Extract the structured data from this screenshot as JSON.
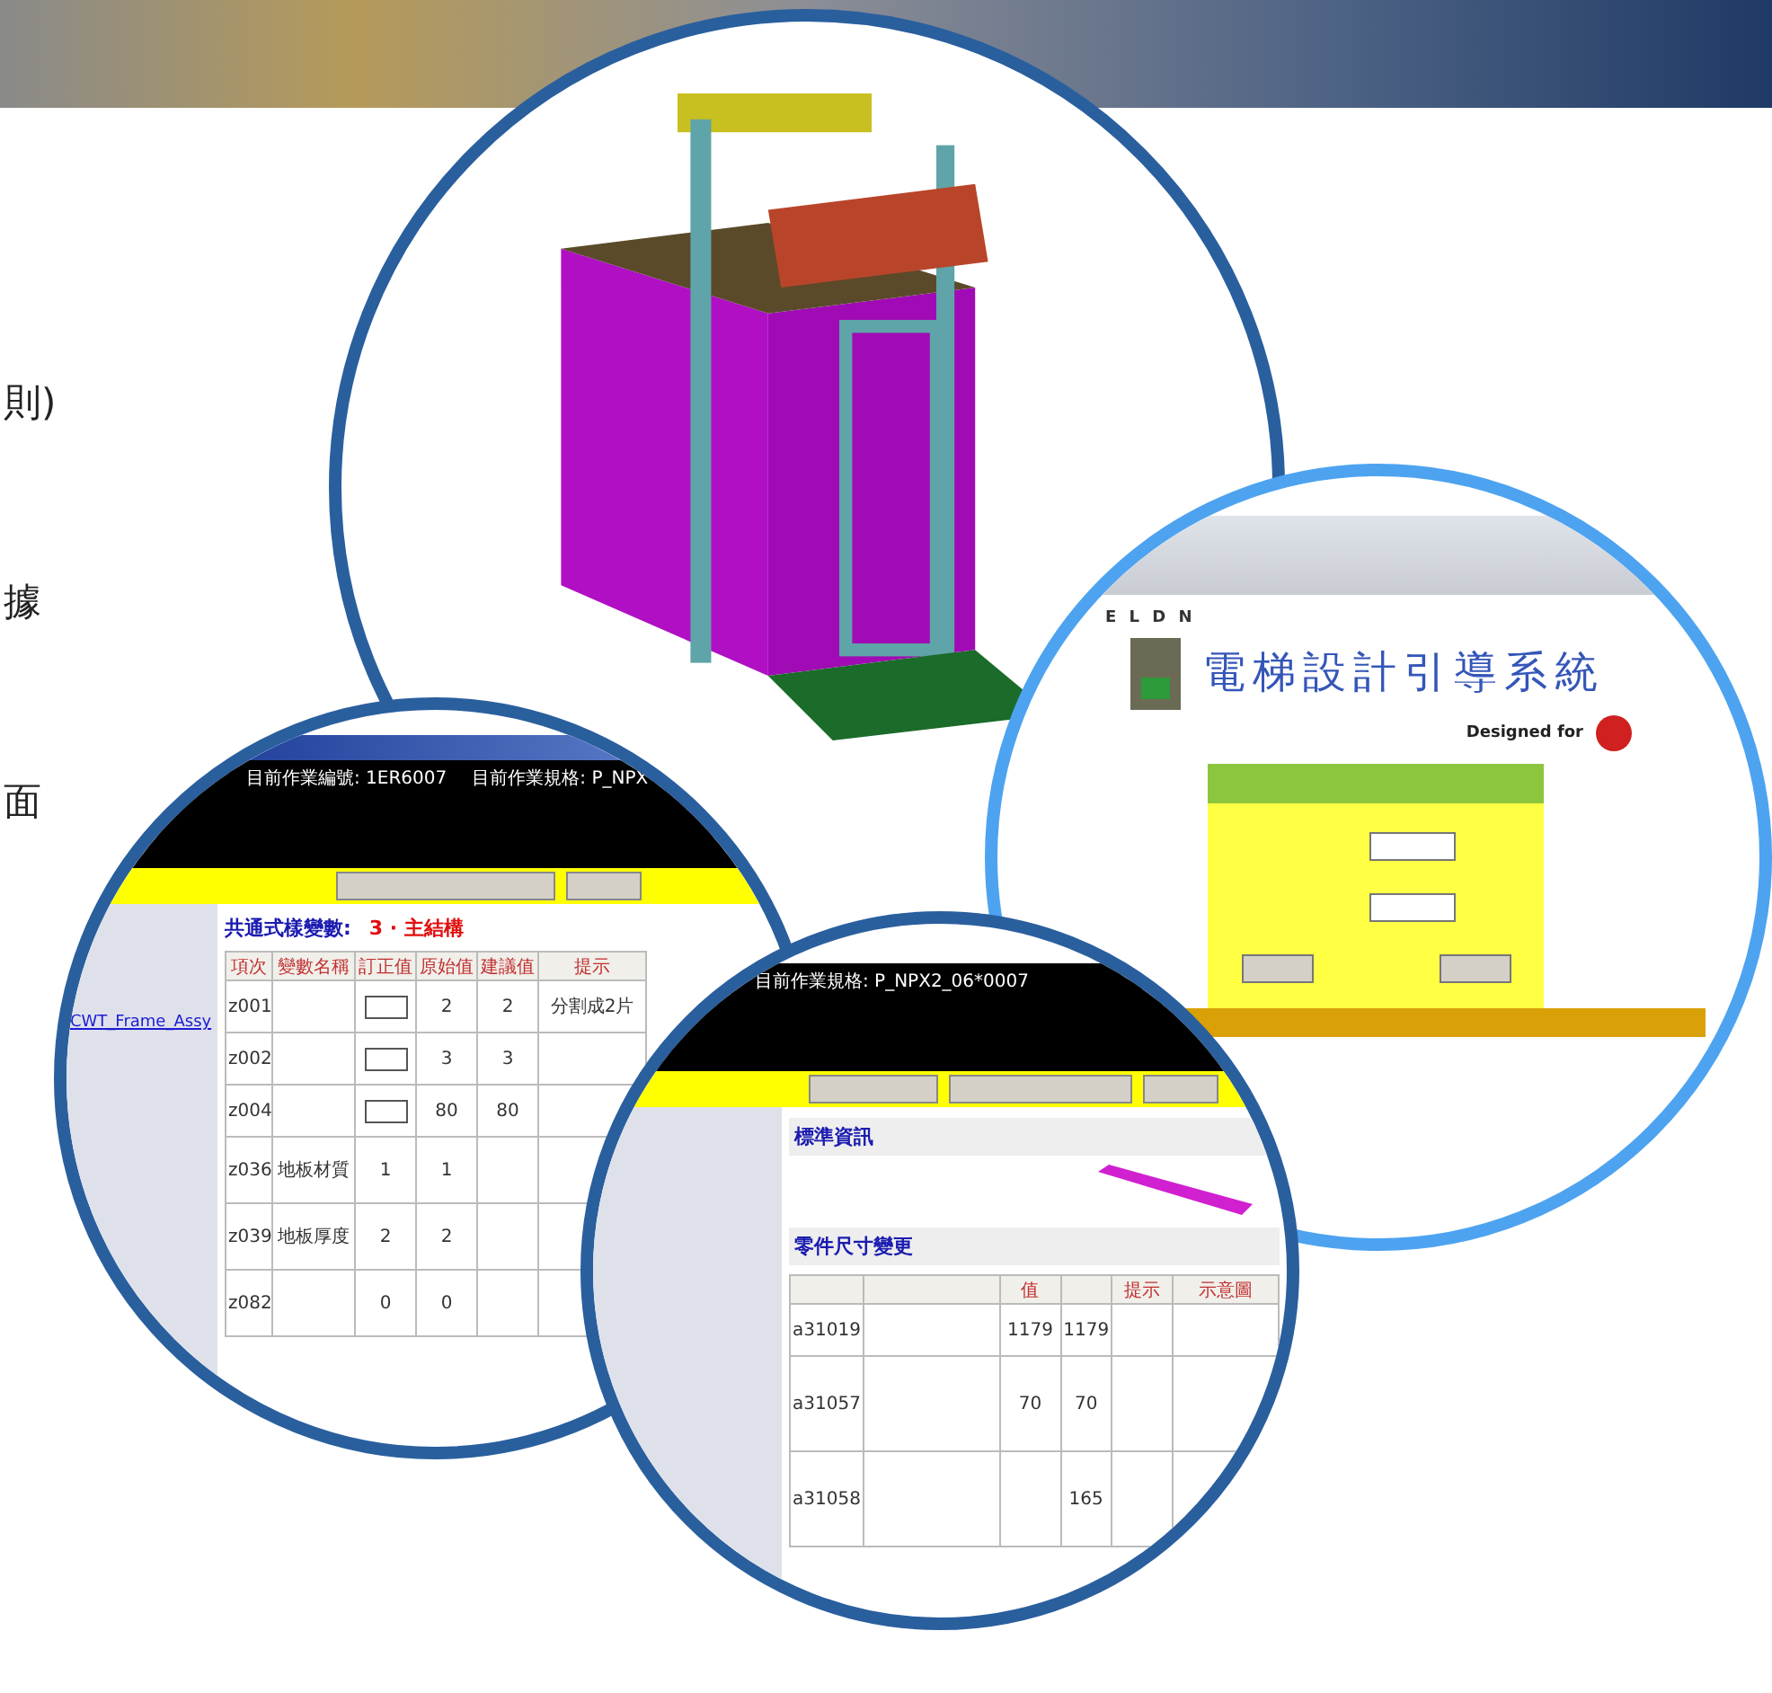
{
  "left_text": [
    "則)",
    "據",
    "面"
  ],
  "login_window": {
    "brand": "E L D N",
    "title": "電梯設計引導系統",
    "designed_for": "Designed for"
  },
  "variables_window": {
    "job_number": "目前作業編號: 1ER6007",
    "job_spec": "目前作業規格: P_NPX",
    "heading": "共通式樣變數:",
    "section": "3 · 主結構",
    "sidebar_links": [
      "CWT_Frame_Assy"
    ],
    "columns": [
      "項次",
      "變數名稱",
      "訂正值",
      "原始值",
      "建議值",
      "提示"
    ],
    "rows": [
      {
        "code": "z001",
        "kind": "select",
        "original": "2",
        "suggested": "2",
        "hint": "分割成2片"
      },
      {
        "code": "z002",
        "kind": "select",
        "original": "3",
        "suggested": "3"
      },
      {
        "code": "z004",
        "kind": "select",
        "original": "80",
        "suggested": "80"
      },
      {
        "code": "z036",
        "kind": "text",
        "name": "地板材質",
        "corrected": "1",
        "original": "1"
      },
      {
        "code": "z039",
        "kind": "text",
        "name": "地板厚度",
        "corrected": "2",
        "original": "2"
      },
      {
        "code": "z082",
        "kind": "text",
        "corrected": "0",
        "original": "0"
      }
    ]
  },
  "parts_window": {
    "job_spec": "目前作業規格: P_NPX2_06*0007",
    "info_heading": "標準資訊",
    "dims_heading": "零件尺寸變更",
    "value_header": "值",
    "hint_header": "提示",
    "diagram_header": "示意圖",
    "rows": [
      {
        "code": "a31019",
        "value": "1179",
        "original": "1179"
      },
      {
        "code": "a31057",
        "value": "70",
        "original": "70"
      },
      {
        "code": "a31058",
        "original": "165"
      }
    ]
  }
}
